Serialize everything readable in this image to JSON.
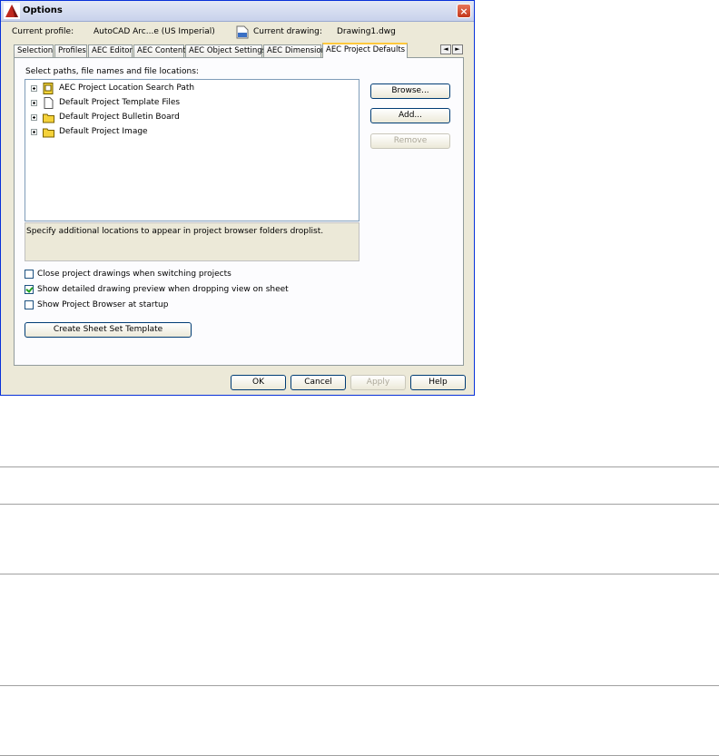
{
  "window": {
    "title": "Options",
    "close_label": "×"
  },
  "profile": {
    "current_profile_label": "Current profile:",
    "current_profile_value": "AutoCAD Arc...e (US Imperial)",
    "current_drawing_label": "Current drawing:",
    "current_drawing_value": "Drawing1.dwg"
  },
  "tabs": [
    {
      "label": "Selection",
      "active": false
    },
    {
      "label": "Profiles",
      "active": false
    },
    {
      "label": "AEC Editor",
      "active": false
    },
    {
      "label": "AEC Content",
      "active": false
    },
    {
      "label": "AEC Object Settings",
      "active": false
    },
    {
      "label": "AEC Dimension",
      "active": false
    },
    {
      "label": "AEC Project Defaults",
      "active": true
    }
  ],
  "tab_scroll": {
    "left": "◄",
    "right": "►"
  },
  "panel": {
    "paths_label": "Select paths, file names and file locations:",
    "tree_items": [
      {
        "label": "AEC Project Location Search Path",
        "icon": "project-location-icon"
      },
      {
        "label": "Default Project Template Files",
        "icon": "file-icon"
      },
      {
        "label": "Default Project Bulletin Board",
        "icon": "folder-icon"
      },
      {
        "label": "Default Project Image",
        "icon": "folder-icon"
      }
    ],
    "description": "Specify additional locations to appear in project browser folders droplist.",
    "buttons": {
      "browse": "Browse...",
      "add": "Add...",
      "remove": "Remove"
    },
    "checkboxes": [
      {
        "label": "Close project drawings when switching projects",
        "checked": false
      },
      {
        "label": "Show detailed drawing preview when dropping view on sheet",
        "checked": true
      },
      {
        "label": "Show Project Browser at startup",
        "checked": false
      }
    ],
    "create_template_label": "Create Sheet Set Template"
  },
  "footer": {
    "ok": "OK",
    "cancel": "Cancel",
    "apply": "Apply",
    "help": "Help"
  },
  "colors": {
    "title_accent": "#0831d9",
    "dialog_bg": "#ece9d8",
    "active_tab_accent": "#ffc83c"
  }
}
